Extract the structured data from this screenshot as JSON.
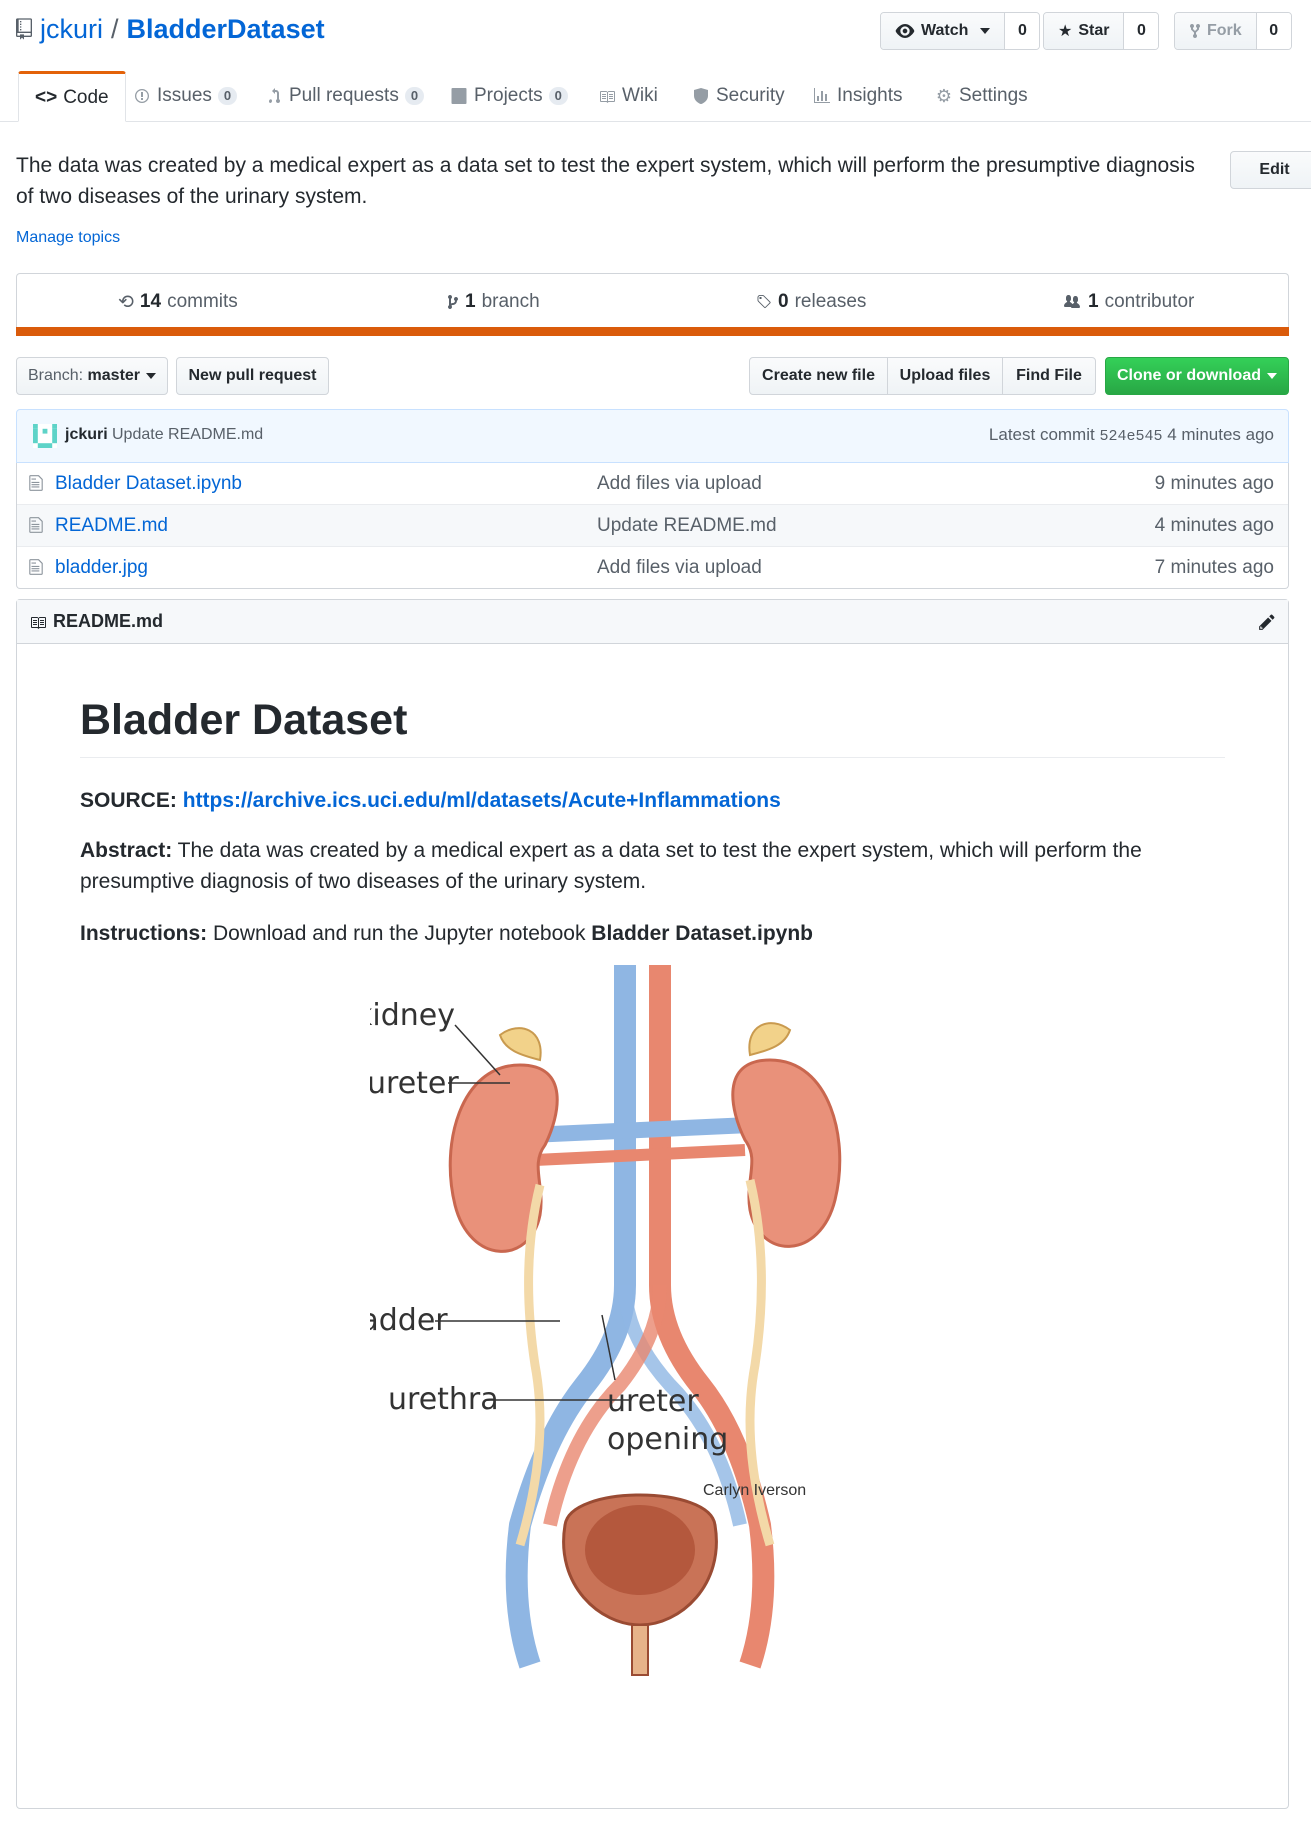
{
  "repo": {
    "owner": "jckuri",
    "separator": "/",
    "name": "BladderDataset"
  },
  "actions": {
    "watch": {
      "label": "Watch",
      "count": "0"
    },
    "star": {
      "label": "Star",
      "count": "0"
    },
    "fork": {
      "label": "Fork",
      "count": "0"
    }
  },
  "tabs": [
    {
      "label": "Code"
    },
    {
      "label": "Issues",
      "count": "0"
    },
    {
      "label": "Pull requests",
      "count": "0"
    },
    {
      "label": "Projects",
      "count": "0"
    },
    {
      "label": "Wiki"
    },
    {
      "label": "Security"
    },
    {
      "label": "Insights"
    },
    {
      "label": "Settings"
    }
  ],
  "description": "The data was created by a medical expert as a data set to test the expert system, which will perform the presumptive diagnosis of two diseases of the urinary system.",
  "edit_label": "Edit",
  "manage_topics": "Manage topics",
  "summary": {
    "commits": {
      "count": "14",
      "label": "commits"
    },
    "branches": {
      "count": "1",
      "label": "branch"
    },
    "releases": {
      "count": "0",
      "label": "releases"
    },
    "contributors": {
      "count": "1",
      "label": "contributor"
    }
  },
  "toolbar": {
    "branch_prefix": "Branch:",
    "branch_name": "master",
    "new_pr": "New pull request",
    "create_file": "Create new file",
    "upload_files": "Upload files",
    "find_file": "Find File",
    "clone": "Clone or download"
  },
  "latest_commit": {
    "author": "jckuri",
    "message": "Update README.md",
    "prefix": "Latest commit",
    "sha": "524e545",
    "age": "4 minutes ago"
  },
  "files": [
    {
      "name": "Bladder Dataset.ipynb",
      "message": "Add files via upload",
      "age": "9 minutes ago"
    },
    {
      "name": "README.md",
      "message": "Update README.md",
      "age": "4 minutes ago"
    },
    {
      "name": "bladder.jpg",
      "message": "Add files via upload",
      "age": "7 minutes ago"
    }
  ],
  "readme": {
    "filename": "README.md",
    "title": "Bladder Dataset",
    "source_label": "SOURCE:",
    "source_url": "https://archive.ics.uci.edu/ml/datasets/Acute+Inflammations",
    "abstract_label": "Abstract:",
    "abstract_text": "The data was created by a medical expert as a data set to test the expert system, which will perform the presumptive diagnosis of two diseases of the urinary system.",
    "instructions_label": "Instructions:",
    "instructions_text": "Download and run the Jupyter notebook",
    "instructions_file": "Bladder Dataset.ipynb",
    "figure_labels": {
      "kidney": "kidney",
      "ureter": "ureter",
      "bladder": "bladder",
      "urethra": "urethra",
      "ureter_opening_1": "ureter",
      "ureter_opening_2": "opening",
      "credit": "Carlyn Iverson"
    }
  },
  "colors": {
    "accent": "#e36209",
    "link": "#0366d6",
    "green": "#28a745",
    "lang_bar": "#da5b0b"
  }
}
